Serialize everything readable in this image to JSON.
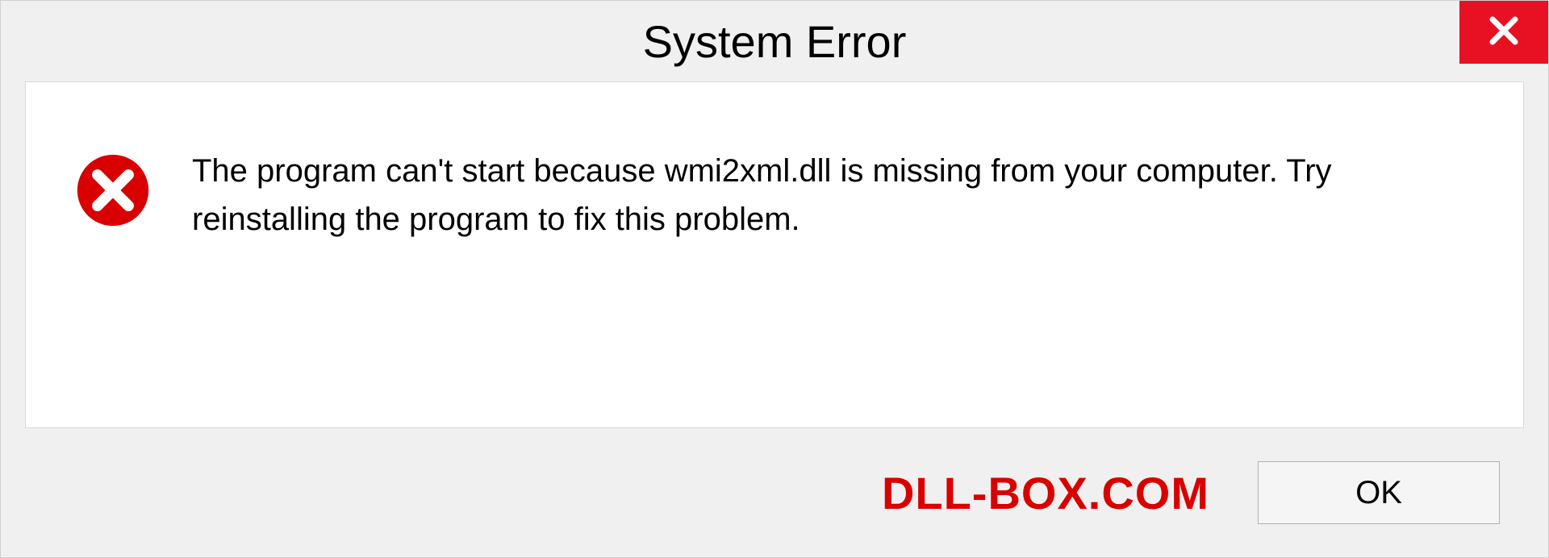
{
  "dialog": {
    "title": "System Error",
    "message": "The program can't start because wmi2xml.dll is missing from your computer. Try reinstalling the program to fix this problem.",
    "ok_label": "OK"
  },
  "watermark": "DLL-BOX.COM",
  "colors": {
    "close_bg": "#e81123",
    "error_red": "#d80000",
    "body_bg": "#f0f0f0"
  }
}
